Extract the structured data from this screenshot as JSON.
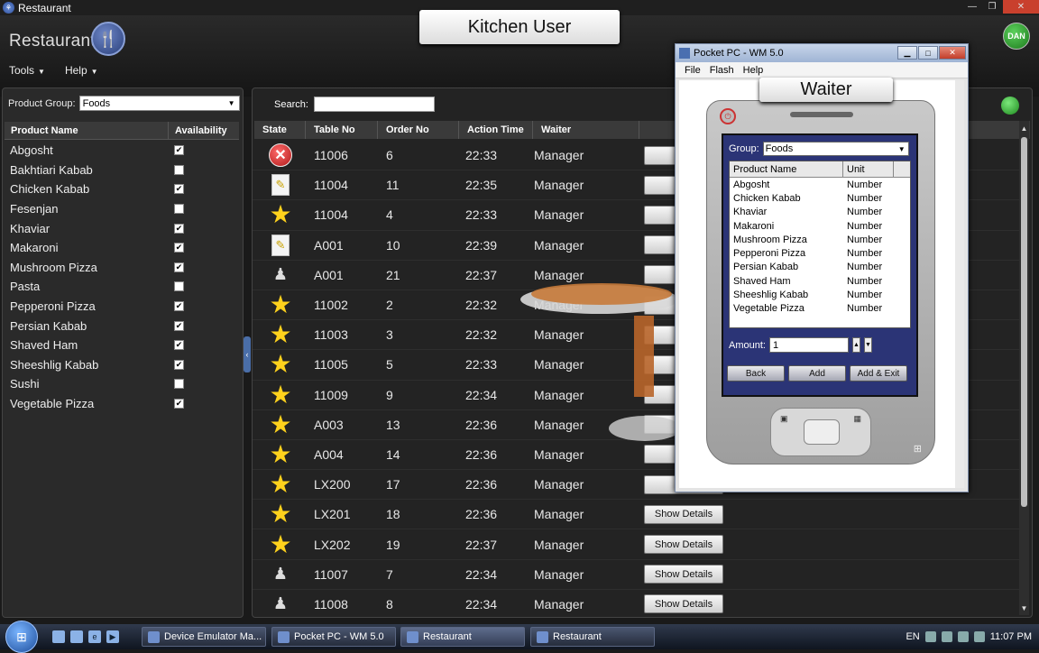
{
  "window": {
    "title": "Restaurant",
    "controls": [
      "—",
      "❐",
      "✕"
    ]
  },
  "app": {
    "name": "Restaurant",
    "logo_glyph": "🍴",
    "user_badge": "DAN",
    "menu": [
      {
        "label": "Tools"
      },
      {
        "label": "Help"
      }
    ]
  },
  "overlays": {
    "kitchen_label": "Kitchen User",
    "waiter_label": "Waiter"
  },
  "left_panel": {
    "group_label": "Product Group:",
    "group_value": "Foods",
    "col_name": "Product Name",
    "col_availability": "Availability",
    "products": [
      {
        "name": "Abgosht",
        "available": true
      },
      {
        "name": "Bakhtiari Kabab",
        "available": false
      },
      {
        "name": "Chicken Kabab",
        "available": true
      },
      {
        "name": "Fesenjan",
        "available": false
      },
      {
        "name": "Khaviar",
        "available": true
      },
      {
        "name": "Makaroni",
        "available": true
      },
      {
        "name": "Mushroom Pizza",
        "available": true
      },
      {
        "name": "Pasta",
        "available": false
      },
      {
        "name": "Pepperoni Pizza",
        "available": true
      },
      {
        "name": "Persian Kabab",
        "available": true
      },
      {
        "name": "Shaved Ham",
        "available": true
      },
      {
        "name": "Sheeshlig Kabab",
        "available": true
      },
      {
        "name": "Sushi",
        "available": false
      },
      {
        "name": "Vegetable Pizza",
        "available": true
      }
    ]
  },
  "main_panel": {
    "search_label": "Search:",
    "search_value": "",
    "columns": [
      "State",
      "Table No",
      "Order No",
      "Action Time",
      "Waiter"
    ],
    "details_label": "Show Details",
    "details_truncated": "Sh",
    "orders": [
      {
        "state": "cancelled-icon",
        "table": "11006",
        "order": "6",
        "time": "22:33",
        "waiter": "Manager"
      },
      {
        "state": "note-icon",
        "table": "11004",
        "order": "11",
        "time": "22:35",
        "waiter": "Manager"
      },
      {
        "state": "star-icon",
        "table": "11004",
        "order": "4",
        "time": "22:33",
        "waiter": "Manager"
      },
      {
        "state": "note-icon",
        "table": "A001",
        "order": "10",
        "time": "22:39",
        "waiter": "Manager"
      },
      {
        "state": "chef-icon",
        "table": "A001",
        "order": "21",
        "time": "22:37",
        "waiter": "Manager"
      },
      {
        "state": "star-icon",
        "table": "11002",
        "order": "2",
        "time": "22:32",
        "waiter": "Manager"
      },
      {
        "state": "star-icon",
        "table": "11003",
        "order": "3",
        "time": "22:32",
        "waiter": "Manager"
      },
      {
        "state": "star-icon",
        "table": "11005",
        "order": "5",
        "time": "22:33",
        "waiter": "Manager"
      },
      {
        "state": "star-icon",
        "table": "11009",
        "order": "9",
        "time": "22:34",
        "waiter": "Manager"
      },
      {
        "state": "star-icon",
        "table": "A003",
        "order": "13",
        "time": "22:36",
        "waiter": "Manager"
      },
      {
        "state": "star-icon",
        "table": "A004",
        "order": "14",
        "time": "22:36",
        "waiter": "Manager"
      },
      {
        "state": "star-icon",
        "table": "LX200",
        "order": "17",
        "time": "22:36",
        "waiter": "Manager"
      },
      {
        "state": "star-icon",
        "table": "LX201",
        "order": "18",
        "time": "22:36",
        "waiter": "Manager"
      },
      {
        "state": "star-icon",
        "table": "LX202",
        "order": "19",
        "time": "22:37",
        "waiter": "Manager"
      },
      {
        "state": "chef-icon",
        "table": "11007",
        "order": "7",
        "time": "22:34",
        "waiter": "Manager"
      },
      {
        "state": "chef-icon",
        "table": "11008",
        "order": "8",
        "time": "22:34",
        "waiter": "Manager"
      }
    ]
  },
  "emulator": {
    "title": "Pocket PC - WM 5.0",
    "menu": [
      "File",
      "Flash",
      "Help"
    ],
    "group_label": "Group:",
    "group_value": "Foods",
    "col_product": "Product Name",
    "col_unit": "Unit",
    "items": [
      {
        "name": "Abgosht",
        "unit": "Number"
      },
      {
        "name": "Chicken Kabab",
        "unit": "Number"
      },
      {
        "name": "Khaviar",
        "unit": "Number"
      },
      {
        "name": "Makaroni",
        "unit": "Number"
      },
      {
        "name": "Mushroom Pizza",
        "unit": "Number"
      },
      {
        "name": "Pepperoni Pizza",
        "unit": "Number"
      },
      {
        "name": "Persian Kabab",
        "unit": "Number"
      },
      {
        "name": "Shaved Ham",
        "unit": "Number"
      },
      {
        "name": "Sheeshlig Kabab",
        "unit": "Number"
      },
      {
        "name": "Vegetable Pizza",
        "unit": "Number"
      }
    ],
    "amount_label": "Amount:",
    "amount_value": "1",
    "buttons": [
      "Back",
      "Add",
      "Add & Exit"
    ]
  },
  "taskbar": {
    "tasks": [
      {
        "label": "Device Emulator Ma..."
      },
      {
        "label": "Pocket PC - WM 5.0"
      },
      {
        "label": "Restaurant"
      },
      {
        "label": "Restaurant"
      }
    ],
    "language": "EN",
    "clock": "11:07 PM"
  }
}
